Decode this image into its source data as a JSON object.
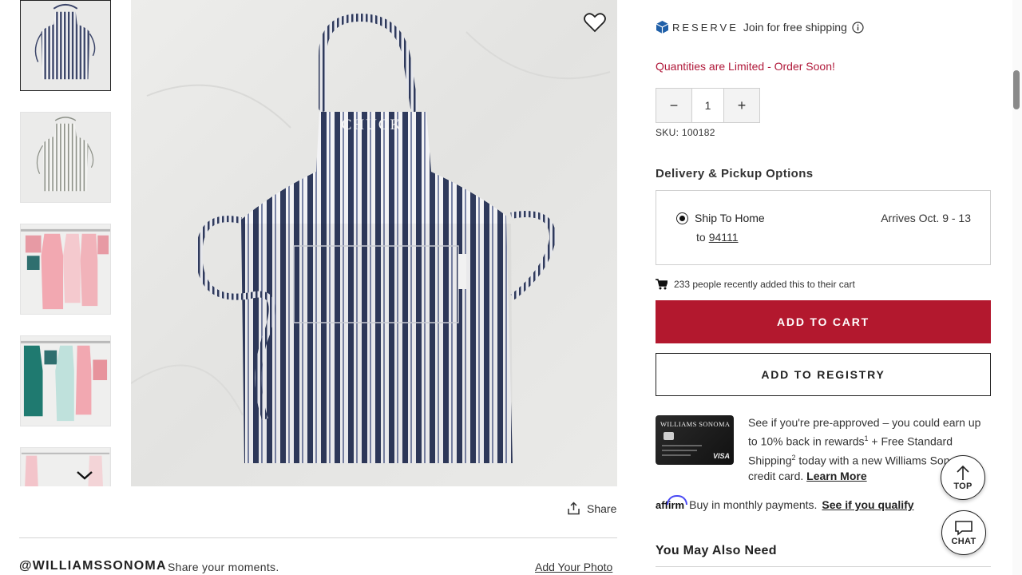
{
  "gallery": {
    "thumbnails": [
      {
        "name": "navy-striped-apron",
        "active": true
      },
      {
        "name": "gray-striped-apron",
        "active": false
      },
      {
        "name": "pink-aprons-hanging",
        "active": false
      },
      {
        "name": "teal-pink-aprons-hanging",
        "active": false
      },
      {
        "name": "apron-partial",
        "active": false
      }
    ],
    "main_embroidery": "CHUCK",
    "share_label": "Share"
  },
  "social": {
    "handle": "@WILLIAMSSONOMA",
    "tagline": "Share your moments.",
    "add_photo": "Add Your Photo"
  },
  "reserve": {
    "logo_text": "RESERVE",
    "join_text": "Join for free shipping"
  },
  "stock_notice": "Quantities are Limited - Order Soon!",
  "quantity": {
    "minus": "−",
    "value": "1",
    "plus": "+"
  },
  "sku": "SKU: 100182",
  "delivery": {
    "title": "Delivery & Pickup Options",
    "option_label": "Ship To Home",
    "to_label": "to",
    "zip": "94111",
    "arrives": "Arrives Oct. 9 - 13"
  },
  "recent_activity": "233 people recently added this to their cart",
  "buttons": {
    "add_to_cart": "ADD TO CART",
    "add_to_registry": "ADD TO REGISTRY"
  },
  "credit": {
    "card_brand": "WILLIAMS SONOMA",
    "card_network": "VISA",
    "text_1": "See if you're pre-approved – you could earn up to 10% back in rewards",
    "sup_1": "1",
    "text_2": " + Free Standard Shipping",
    "sup_2": "2",
    "text_3": " today with a new Williams Sonoma credit card. ",
    "learn_more": "Learn More"
  },
  "affirm": {
    "logo": "affirm",
    "text": "Buy in monthly payments.",
    "qualify": "See if you qualify"
  },
  "also_need": "You May Also Need",
  "floating": {
    "top": "TOP",
    "chat": "CHAT"
  },
  "colors": {
    "accent_red": "#b3182e",
    "notice_red": "#b0193a",
    "stripe_navy": "#2f3a5c"
  }
}
